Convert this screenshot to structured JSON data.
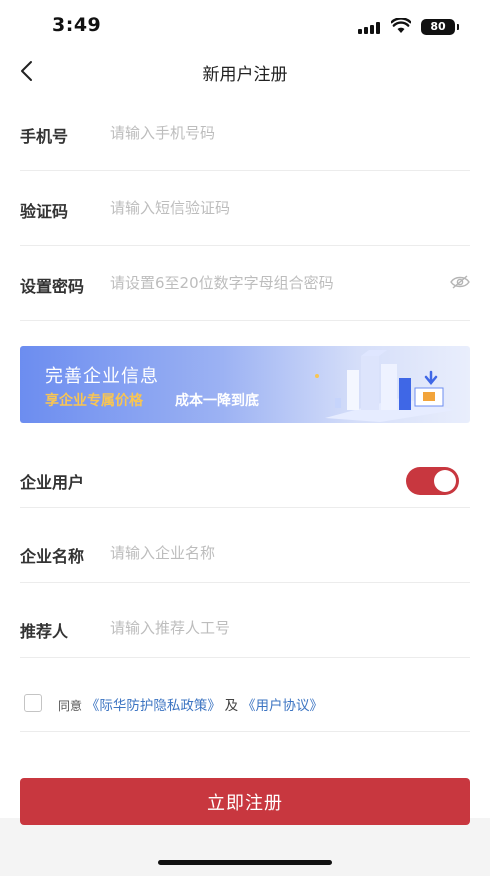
{
  "status_bar": {
    "time": "3:49",
    "battery": "80"
  },
  "nav": {
    "title": "新用户注册",
    "back_icon": "chevron-left-icon"
  },
  "form": {
    "phone": {
      "label": "手机号",
      "placeholder": "请输入手机号码",
      "value": ""
    },
    "code": {
      "label": "验证码",
      "placeholder": "请输入短信验证码",
      "value": ""
    },
    "password": {
      "label": "设置密码",
      "placeholder": "请设置6至20位数字字母组合密码",
      "value": "",
      "toggle_icon": "eye-icon"
    }
  },
  "banner": {
    "title": "完善企业信息",
    "subtitle_highlight": "享企业专属价格",
    "subtitle_rest": "成本一降到底"
  },
  "enterprise": {
    "toggle_label": "企业用户",
    "toggle_on": true,
    "name_label": "企业名称",
    "name_placeholder": "请输入企业名称",
    "referrer_label": "推荐人",
    "referrer_placeholder": "请输入推荐人工号"
  },
  "agreement": {
    "prefix": "同意",
    "privacy_link": "《际华防护隐私政策》",
    "conjunction": "及",
    "terms_link": "《用户协议》",
    "checked": false
  },
  "submit": {
    "label": "立即注册"
  },
  "colors": {
    "accent": "#c8373f",
    "link": "#3c74c2",
    "banner_highlight": "#f8c553"
  }
}
